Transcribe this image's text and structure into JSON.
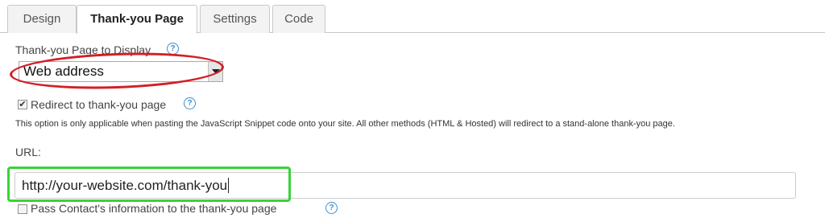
{
  "tabs": [
    {
      "label": "Design"
    },
    {
      "label": "Thank-you Page"
    },
    {
      "label": "Settings"
    },
    {
      "label": "Code"
    }
  ],
  "display_field": {
    "label": "Thank-you Page to Display",
    "help_icon": "question-circle-icon",
    "selected_value": "Web address"
  },
  "redirect": {
    "checked": true,
    "label": "Redirect to thank-you page",
    "help_icon": "question-circle-icon",
    "note": "This option is only applicable when pasting the JavaScript Snippet code onto your site. All other methods (HTML & Hosted) will redirect to a stand-alone thank-you page."
  },
  "url_field": {
    "label": "URL:",
    "value": "http://your-website.com/thank-you"
  },
  "pass_contact": {
    "checked": false,
    "label": "Pass Contact's information to the thank-you page",
    "help_icon": "question-circle-icon"
  },
  "colors": {
    "highlight_red": "#d21f26",
    "highlight_green": "#39d339",
    "help_blue": "#3d8fd1"
  }
}
